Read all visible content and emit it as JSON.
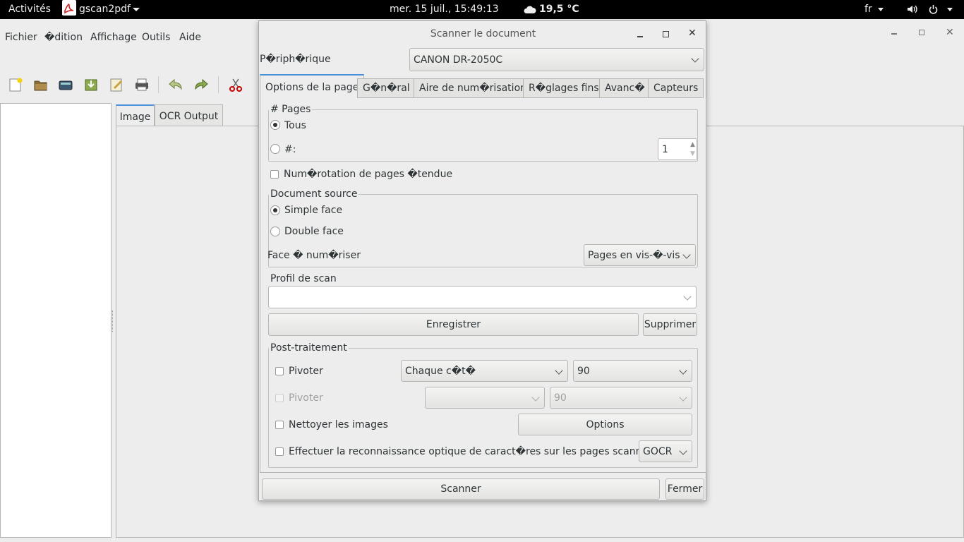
{
  "topbar": {
    "activities": "Activités",
    "app_name": "gscan2pdf",
    "clock": "mer. 15 juil., 15:49:13",
    "weather": "19,5 °C",
    "lang": "fr"
  },
  "menu": {
    "file": "Fichier",
    "edit": "�dition",
    "view": "Affichage",
    "tools": "Outils",
    "help": "Aide"
  },
  "main_tabs": {
    "image": "Image",
    "ocr": "OCR Output"
  },
  "dialog": {
    "title": "Scanner le document",
    "device_label": "P�riph�rique",
    "device_value": "CANON DR-2050C",
    "tabs": [
      "Options de la page",
      "G�n�ral",
      "Aire de num�risation",
      "R�glages fins",
      "Avanc�",
      "Capteurs"
    ],
    "pages": {
      "legend": "# Pages",
      "all_label": "Tous",
      "count_label": "#:",
      "count_value": "1"
    },
    "extended_numbering_label": "Num�rotation de pages �tendue",
    "source": {
      "legend": "Document source",
      "simplex": "Simple face",
      "duplex": "Double face",
      "face_label": "Face � num�riser",
      "face_value": "Pages en vis-�-vis"
    },
    "profile": {
      "legend": "Profil de scan",
      "value": "",
      "save": "Enregistrer",
      "delete": "Supprimer"
    },
    "post": {
      "legend": "Post-traitement",
      "rotate1_label": "Pivoter",
      "rotate1_side": "Chaque c�t�",
      "rotate1_angle": "90",
      "rotate2_label": "Pivoter",
      "rotate2_side": "",
      "rotate2_angle": "90",
      "clean_label": "Nettoyer les images",
      "options_button": "Options",
      "ocr_label": "Effectuer la reconnaissance optique de caract�res sur les pages scann�es",
      "ocr_engine": "GOCR"
    },
    "scan_button": "Scanner",
    "close_button": "Fermer"
  },
  "colors": {
    "accent": "#4a90d9",
    "topbar_bg": "#000000",
    "window_bg": "#ededed"
  }
}
